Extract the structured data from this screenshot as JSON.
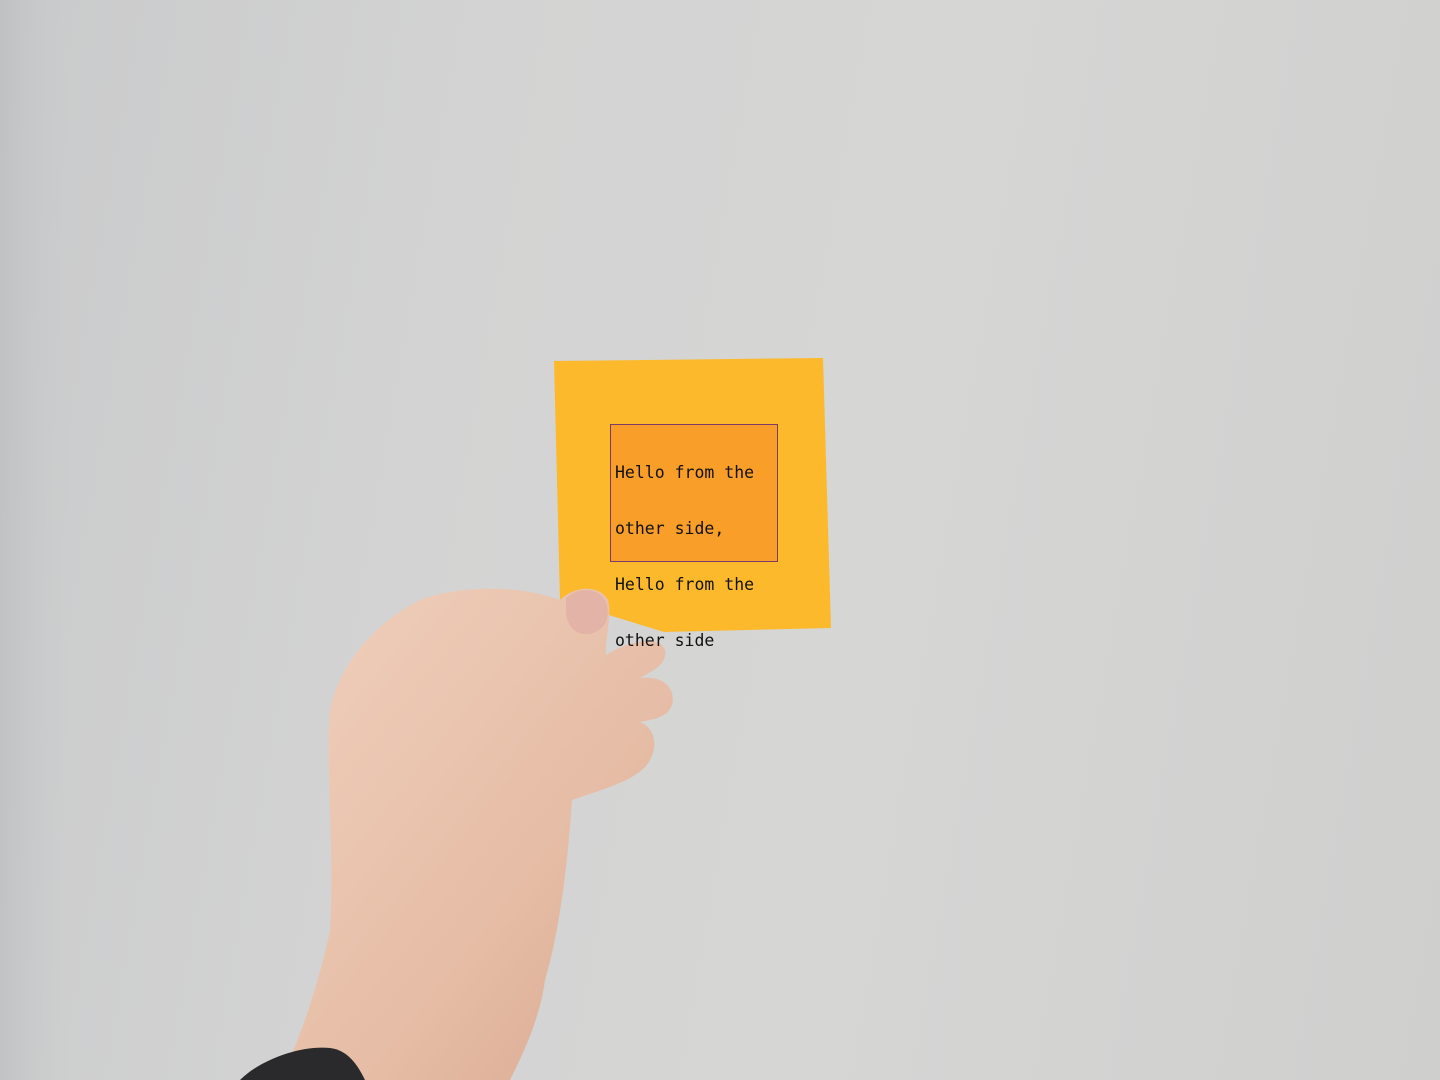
{
  "note": {
    "lines": [
      "Hello from the",
      "other side,",
      "Hello from the",
      "other side"
    ]
  },
  "colors": {
    "wall": "#d3d3d3",
    "sticky_note": "#fdb92c",
    "text_box": "#f5962a",
    "skin": "#e9c2ac"
  }
}
